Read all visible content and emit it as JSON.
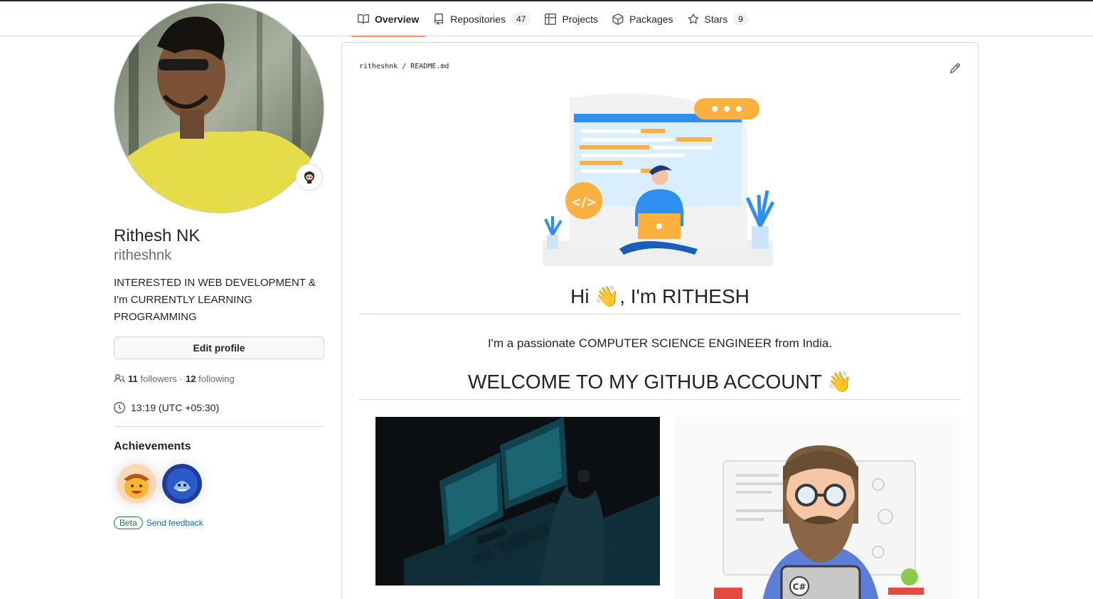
{
  "tabs": [
    {
      "label": "Overview",
      "icon": "book-icon",
      "active": true,
      "count": null
    },
    {
      "label": "Repositories",
      "icon": "repo-icon",
      "active": false,
      "count": "47"
    },
    {
      "label": "Projects",
      "icon": "table-icon",
      "active": false,
      "count": null
    },
    {
      "label": "Packages",
      "icon": "package-icon",
      "active": false,
      "count": null
    },
    {
      "label": "Stars",
      "icon": "star-icon",
      "active": false,
      "count": "9"
    }
  ],
  "profile": {
    "name": "Rithesh NK",
    "login": "ritheshnk",
    "bio": "INTERESTED IN WEB DEVELOPMENT & I'm CURRENTLY LEARNING PROGRAMMING",
    "edit_label": "Edit profile",
    "followers_count": "11",
    "followers_label": "followers",
    "separator": "·",
    "following_count": "12",
    "following_label": "following",
    "local_time": "13:19 (UTC +05:30)",
    "achievements_title": "Achievements",
    "beta_label": "Beta",
    "feedback_label": "Send feedback"
  },
  "readme": {
    "path": "ritheshnk / README.md",
    "heading": "Hi 👋, I'm RITHESH",
    "intro": "I'm a passionate COMPUTER SCIENCE ENGINEER from India.",
    "welcome": "WELCOME TO MY GITHUB ACCOUNT 👋"
  },
  "colors": {
    "accent_underline": "#fd8c73",
    "link": "#0969da",
    "beta_green": "#1a7f37",
    "border": "#d0d7de",
    "hero_blue": "#2f8ff0",
    "hero_orange": "#fbb040"
  }
}
